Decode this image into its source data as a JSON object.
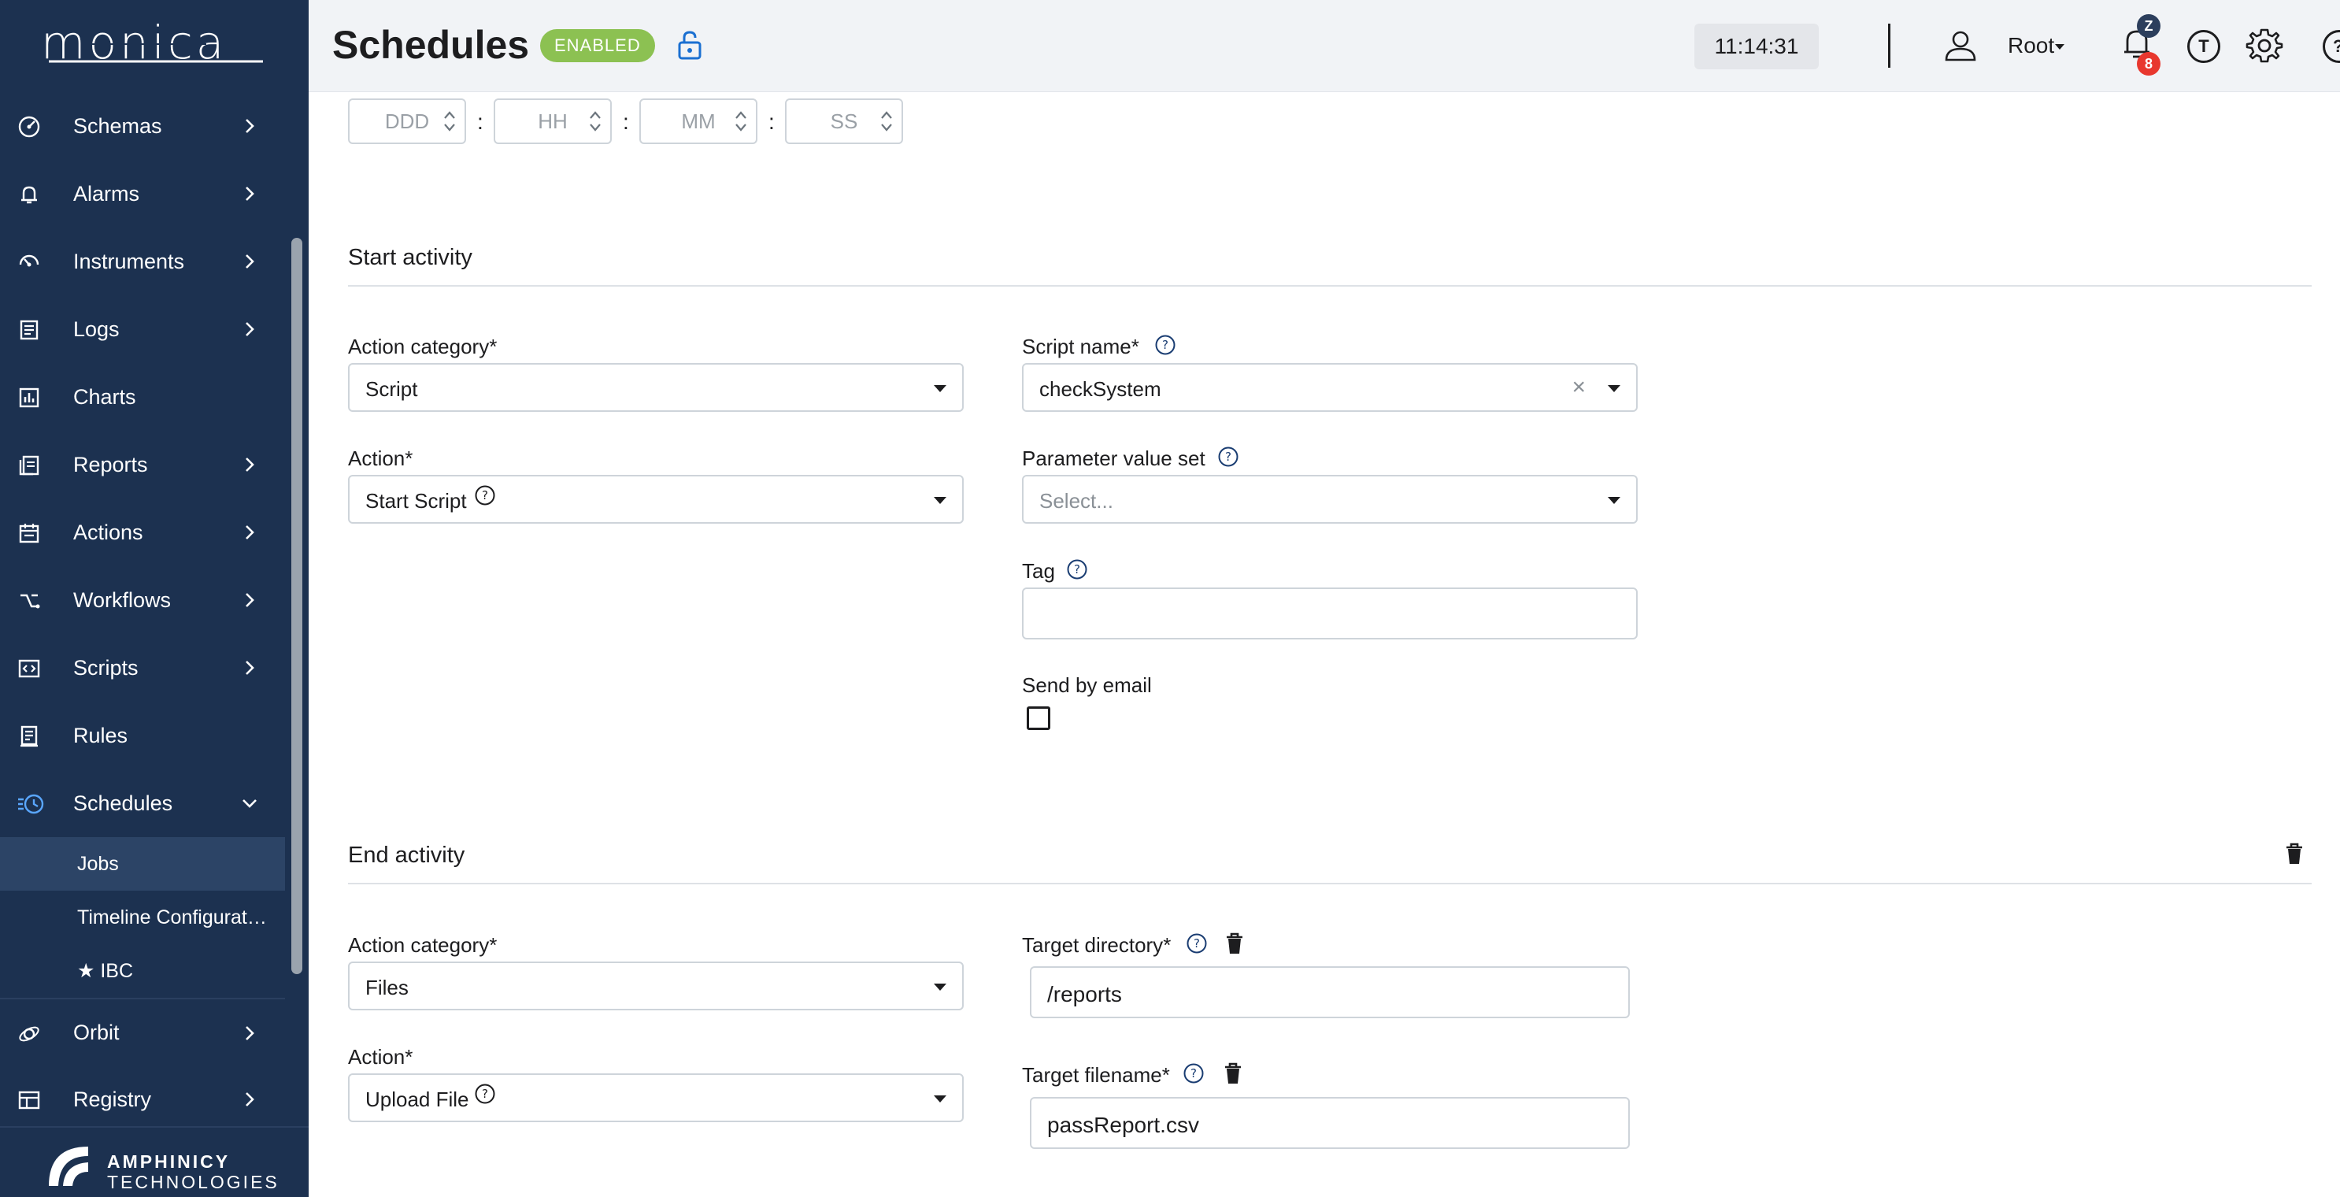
{
  "sidebar": {
    "logo_text": "monica",
    "items": [
      {
        "label": "Schemas",
        "icon": "dashboard-icon",
        "expandable": true
      },
      {
        "label": "Alarms",
        "icon": "bell-icon",
        "expandable": true
      },
      {
        "label": "Instruments",
        "icon": "gauge-icon",
        "expandable": true
      },
      {
        "label": "Logs",
        "icon": "log-icon",
        "expandable": true
      },
      {
        "label": "Charts",
        "icon": "chart-icon",
        "expandable": false
      },
      {
        "label": "Reports",
        "icon": "report-icon",
        "expandable": true
      },
      {
        "label": "Actions",
        "icon": "calendar-icon",
        "expandable": true
      },
      {
        "label": "Workflows",
        "icon": "workflow-icon",
        "expandable": true
      },
      {
        "label": "Scripts",
        "icon": "code-icon",
        "expandable": true
      },
      {
        "label": "Rules",
        "icon": "rules-icon",
        "expandable": false
      },
      {
        "label": "Schedules",
        "icon": "schedule-icon",
        "expandable": true
      }
    ],
    "sub_items": [
      {
        "label": "Jobs"
      },
      {
        "label": "Timeline Configurat…"
      },
      {
        "label": "★ IBC"
      }
    ],
    "items_after": [
      {
        "label": "Orbit",
        "icon": "orbit-icon"
      },
      {
        "label": "Registry",
        "icon": "registry-icon"
      }
    ],
    "footer": {
      "line1": "AMPHINICY",
      "line2": "TECHNOLOGIES"
    }
  },
  "header": {
    "title": "Schedules",
    "badge": "ENABLED",
    "clock": "11:14:31",
    "user": "Root",
    "notif_z": "Z",
    "notif_count": "8",
    "t_label": "T",
    "help_label": "?"
  },
  "duration": {
    "fields": [
      {
        "placeholder": "DDD"
      },
      {
        "placeholder": "HH"
      },
      {
        "placeholder": "MM"
      },
      {
        "placeholder": "SS"
      }
    ],
    "separator": ":"
  },
  "start_activity": {
    "title": "Start activity",
    "action_category_label": "Action category",
    "action_category_value": "Script",
    "action_label": "Action",
    "action_value": "Start Script",
    "script_name_label": "Script name",
    "script_name_value": "checkSystem",
    "param_set_label": "Parameter value set",
    "param_set_placeholder": "Select...",
    "tag_label": "Tag",
    "tag_value": "",
    "send_email_label": "Send by email",
    "required_mark": "*"
  },
  "end_activity": {
    "title": "End activity",
    "action_category_label": "Action category",
    "action_category_value": "Files",
    "action_label": "Action",
    "action_value": "Upload File",
    "target_dir_label": "Target directory",
    "target_dir_value": "/reports",
    "target_file_label": "Target filename",
    "target_file_value": "passReport.csv",
    "required_mark": "*"
  },
  "colors": {
    "sidebar_bg": "#1c3150",
    "badge_green": "#8cc152",
    "accent_blue": "#1a6fd1",
    "notif_red": "#e8372e"
  }
}
